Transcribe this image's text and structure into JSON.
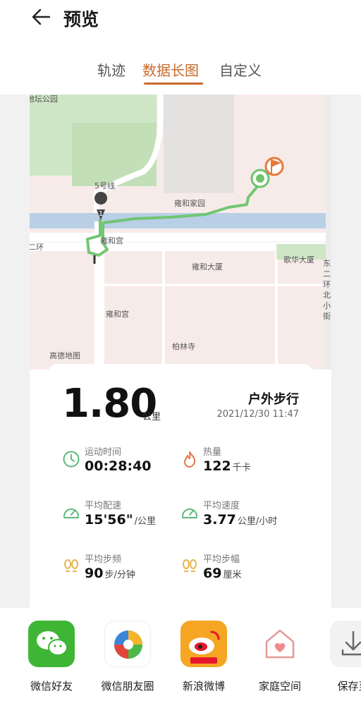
{
  "header": {
    "title": "预览"
  },
  "tabs": [
    {
      "label": "轨迹"
    },
    {
      "label": "数据长图"
    },
    {
      "label": "自定义"
    }
  ],
  "map": {
    "labels": {
      "park": "地坛公园",
      "line5": "5号线",
      "yonghe_home": "雍和家园",
      "yonghegong_road": "雍和宫",
      "second_ring": "二环",
      "yonghe_mansion": "雍和大厦",
      "gewa_mansion": "歌华大厦",
      "yonghegong": "雍和宫",
      "amap": "高德地图",
      "bailinsi": "柏林寺",
      "right_vertical": "东二环北小街"
    },
    "start_marker": "1"
  },
  "summary": {
    "distance": "1.80",
    "distance_unit": "公里",
    "activity": "户外步行",
    "datetime": "2021/12/30 11:47"
  },
  "metrics": {
    "duration": {
      "label": "运动时间",
      "value": "00:28:40",
      "unit": ""
    },
    "calories": {
      "label": "热量",
      "value": "122",
      "unit": "千卡"
    },
    "pace": {
      "label": "平均配速",
      "value": "15'56\"",
      "unit": "/公里"
    },
    "speed": {
      "label": "平均速度",
      "value": "3.77",
      "unit": "公里/小时"
    },
    "cadence": {
      "label": "平均步频",
      "value": "90",
      "unit": "步/分钟"
    },
    "stride": {
      "label": "平均步幅",
      "value": "69",
      "unit": "厘米"
    }
  },
  "share": [
    {
      "label": "微信好友"
    },
    {
      "label": "微信朋友圈"
    },
    {
      "label": "新浪微博"
    },
    {
      "label": "家庭空间"
    },
    {
      "label": "保存至"
    }
  ],
  "colors": {
    "accent": "#c96a2c",
    "track": "#6dc46b",
    "metric_green": "#5cb97a",
    "metric_orange": "#e07a4a",
    "metric_yellow": "#e8b44c"
  }
}
